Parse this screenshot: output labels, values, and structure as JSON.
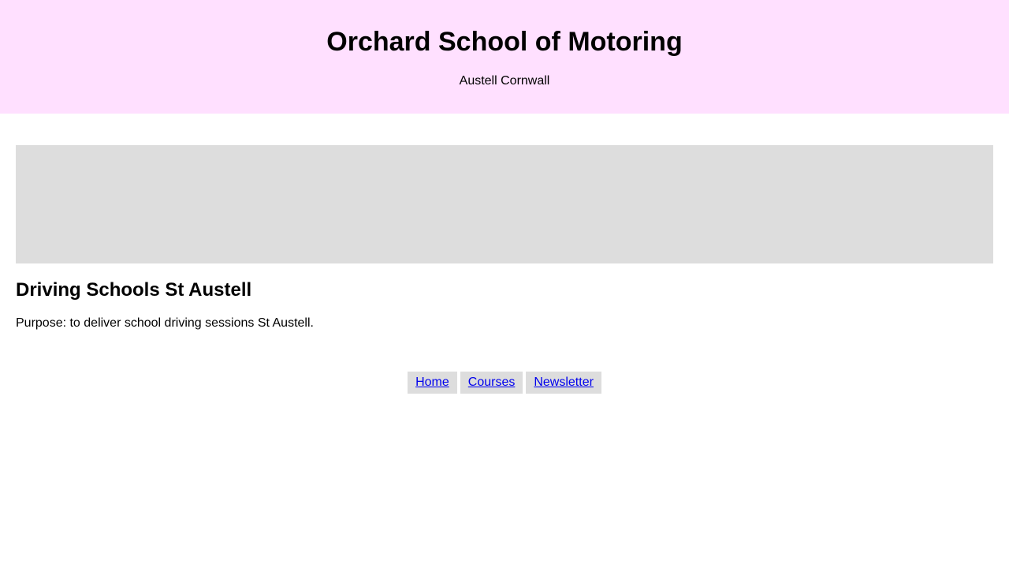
{
  "header": {
    "title": "Orchard School of Motoring",
    "location": "Austell Cornwall",
    "background_color": "#ffe0ff"
  },
  "main": {
    "image_placeholder_color": "#dddddd",
    "heading": "Driving Schools St Austell",
    "text": "Purpose: to deliver school driving sessions St Austell."
  },
  "footer_nav": {
    "links": [
      {
        "label": "Home"
      },
      {
        "label": "Courses"
      },
      {
        "label": "Newsletter"
      }
    ],
    "link_color": "#0000ee",
    "link_background": "#dddddd"
  }
}
